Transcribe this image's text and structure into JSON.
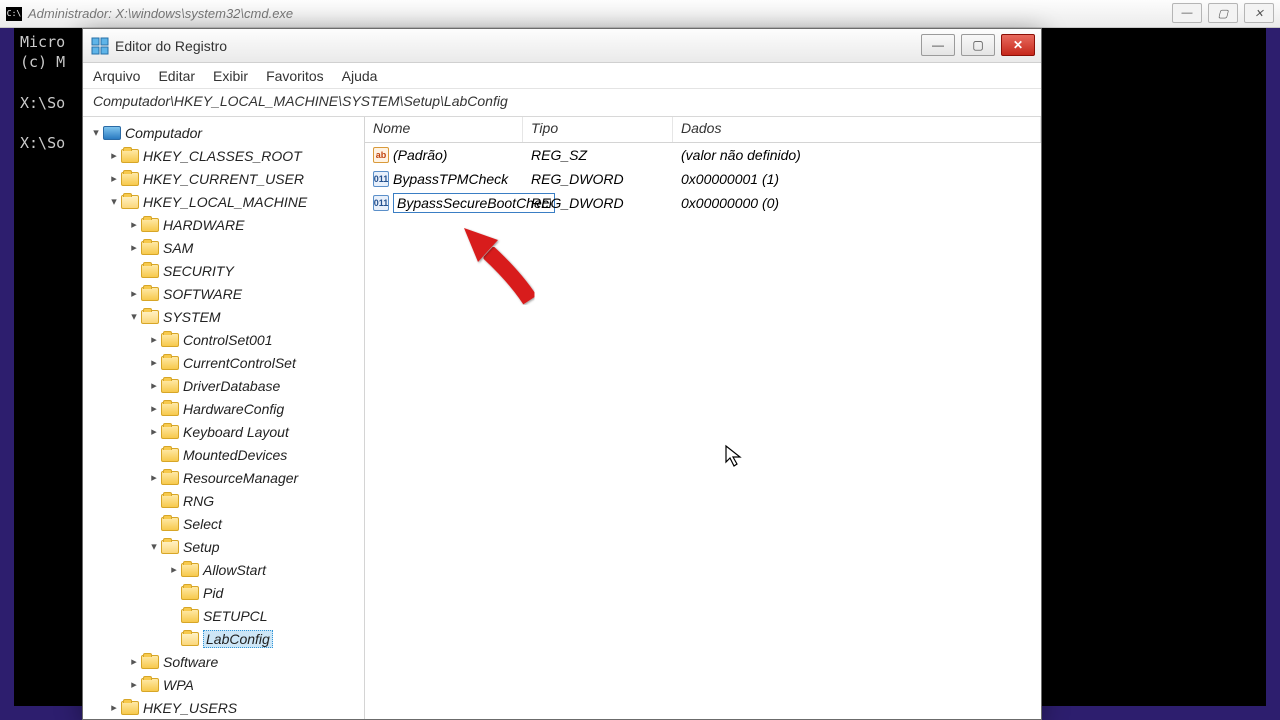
{
  "cmd": {
    "title": "Administrador: X:\\windows\\system32\\cmd.exe",
    "body_text": "Micro\n(c) M\n\nX:\\So\n\nX:\\So"
  },
  "regedit": {
    "title": "Editor do Registro",
    "menus": {
      "file": "Arquivo",
      "edit": "Editar",
      "view": "Exibir",
      "favorites": "Favoritos",
      "help": "Ajuda"
    },
    "address": "Computador\\HKEY_LOCAL_MACHINE\\SYSTEM\\Setup\\LabConfig",
    "tree": {
      "root": "Computador",
      "items": [
        {
          "label": "HKEY_CLASSES_ROOT",
          "depth": 1,
          "expandable": true
        },
        {
          "label": "HKEY_CURRENT_USER",
          "depth": 1,
          "expandable": true
        },
        {
          "label": "HKEY_LOCAL_MACHINE",
          "depth": 1,
          "expandable": true,
          "expanded": true
        },
        {
          "label": "HARDWARE",
          "depth": 2,
          "expandable": true
        },
        {
          "label": "SAM",
          "depth": 2,
          "expandable": true
        },
        {
          "label": "SECURITY",
          "depth": 2,
          "expandable": false
        },
        {
          "label": "SOFTWARE",
          "depth": 2,
          "expandable": true
        },
        {
          "label": "SYSTEM",
          "depth": 2,
          "expandable": true,
          "expanded": true
        },
        {
          "label": "ControlSet001",
          "depth": 3,
          "expandable": true
        },
        {
          "label": "CurrentControlSet",
          "depth": 3,
          "expandable": true
        },
        {
          "label": "DriverDatabase",
          "depth": 3,
          "expandable": true
        },
        {
          "label": "HardwareConfig",
          "depth": 3,
          "expandable": true
        },
        {
          "label": "Keyboard Layout",
          "depth": 3,
          "expandable": true
        },
        {
          "label": "MountedDevices",
          "depth": 3,
          "expandable": false
        },
        {
          "label": "ResourceManager",
          "depth": 3,
          "expandable": true
        },
        {
          "label": "RNG",
          "depth": 3,
          "expandable": false
        },
        {
          "label": "Select",
          "depth": 3,
          "expandable": false
        },
        {
          "label": "Setup",
          "depth": 3,
          "expandable": true,
          "expanded": true
        },
        {
          "label": "AllowStart",
          "depth": 4,
          "expandable": true
        },
        {
          "label": "Pid",
          "depth": 4,
          "expandable": false
        },
        {
          "label": "SETUPCL",
          "depth": 4,
          "expandable": false
        },
        {
          "label": "LabConfig",
          "depth": 4,
          "expandable": false,
          "selected": true
        },
        {
          "label": "Software",
          "depth": 2,
          "expandable": true
        },
        {
          "label": "WPA",
          "depth": 2,
          "expandable": true
        },
        {
          "label": "HKEY_USERS",
          "depth": 1,
          "expandable": true
        }
      ]
    },
    "columns": {
      "name": "Nome",
      "type": "Tipo",
      "data": "Dados"
    },
    "values": [
      {
        "icon": "str",
        "name": "(Padrão)",
        "type": "REG_SZ",
        "data": "(valor não definido)"
      },
      {
        "icon": "bin",
        "name": "BypassTPMCheck",
        "type": "REG_DWORD",
        "data": "0x00000001 (1)"
      },
      {
        "icon": "bin",
        "name_editing": "BypassSecureBootCheck",
        "type": "REG_DWORD",
        "data": "0x00000000 (0)"
      }
    ]
  }
}
